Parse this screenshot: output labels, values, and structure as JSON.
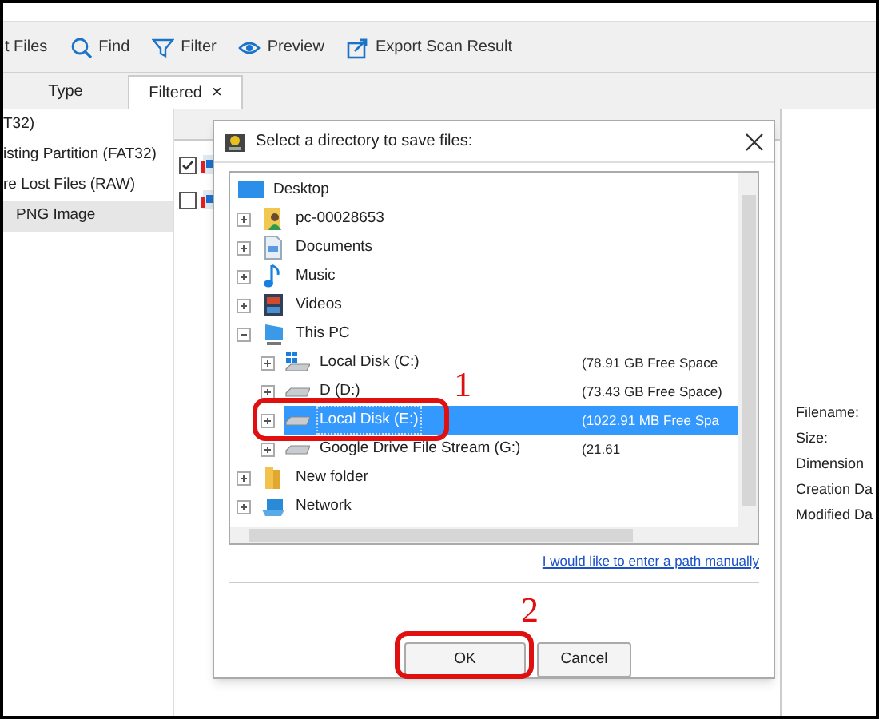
{
  "toolbar": [
    {
      "label": "t Files"
    },
    {
      "label": "Find"
    },
    {
      "label": "Filter"
    },
    {
      "label": "Preview"
    },
    {
      "label": "Export Scan Result"
    }
  ],
  "tabs": [
    {
      "label": "Type",
      "selected": false
    },
    {
      "label": "Filtered",
      "selected": true,
      "close": "×"
    }
  ],
  "sidebar": {
    "items": [
      {
        "label": "T32)",
        "selected": false
      },
      {
        "label": "isting Partition (FAT32)",
        "selected": false
      },
      {
        "label": "re Lost Files (RAW)",
        "selected": false
      },
      {
        "label": "PNG Image",
        "selected": true
      }
    ]
  },
  "table": {
    "rows": [
      {
        "checked": true
      },
      {
        "checked": false
      }
    ]
  },
  "details": {
    "labels": [
      "Filename:",
      "Size:",
      "Dimension",
      "Creation Da",
      "Modified Da"
    ]
  },
  "dialog": {
    "title": "Select a directory to save files:",
    "tree": [
      {
        "label": "Desktop",
        "kind": "desktop",
        "children": [
          {
            "label": "pc-00028653",
            "kind": "user",
            "expanded": false
          },
          {
            "label": "Documents",
            "kind": "document",
            "expanded": false
          },
          {
            "label": "Music",
            "kind": "music",
            "expanded": false
          },
          {
            "label": "Videos",
            "kind": "video",
            "expanded": false
          },
          {
            "label": "This PC",
            "kind": "pc",
            "expanded": true,
            "children": [
              {
                "label": "Local Disk (C:)",
                "kind": "windrive",
                "expanded": false,
                "free": "(78.91 GB Free Space",
                "selected": false
              },
              {
                "label": "D (D:)",
                "kind": "drive",
                "expanded": false,
                "free": "(73.43 GB Free Space)",
                "selected": false
              },
              {
                "label": "Local Disk (E:)",
                "kind": "drive",
                "expanded": false,
                "free": "(1022.91 MB Free Spa",
                "selected": true,
                "annotation": "1"
              },
              {
                "label": "Google Drive File Stream (G:)",
                "kind": "drive",
                "expanded": false,
                "free": "(21.61",
                "selected": false
              }
            ]
          },
          {
            "label": "New folder",
            "kind": "folder",
            "expanded": false
          },
          {
            "label": "Network",
            "kind": "network",
            "expanded": false
          }
        ]
      }
    ],
    "link": "I would like to enter a path manually",
    "buttons": [
      {
        "label": "OK",
        "annotation": "2"
      },
      {
        "label": "Cancel"
      }
    ]
  }
}
